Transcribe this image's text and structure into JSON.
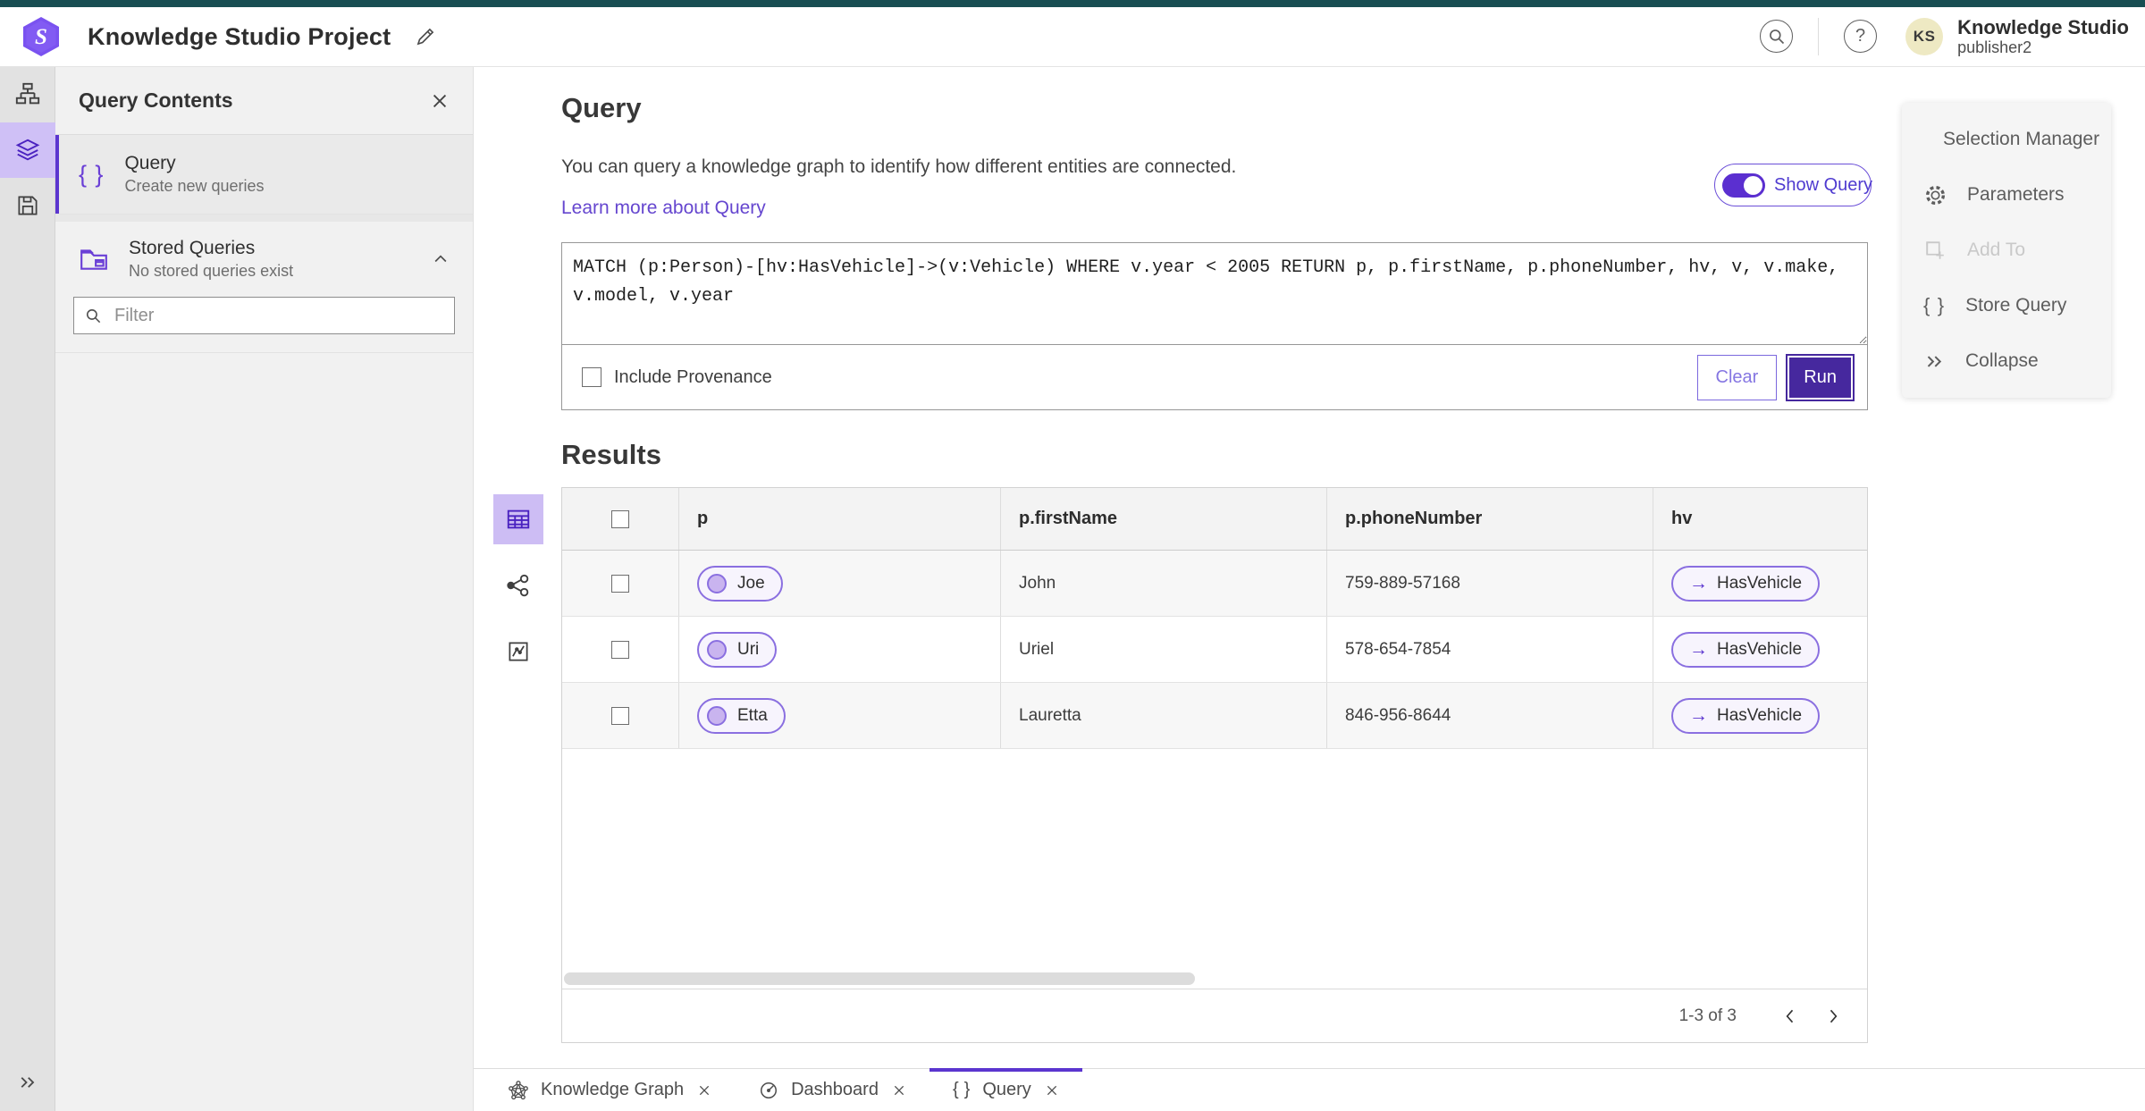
{
  "colors": {
    "accent_purple": "#5b35cf",
    "accent_deep_purple": "#46289e",
    "accent_light_purple": "#cdbdf4",
    "top_strip_teal": "#184e52",
    "avatar_yellow": "#eee9c3"
  },
  "header": {
    "app_title": "Knowledge Studio Project",
    "user_name": "Knowledge Studio",
    "user_role": "publisher2",
    "avatar_initials": "KS"
  },
  "contents_panel": {
    "title": "Query Contents",
    "query_item": {
      "label": "Query",
      "sublabel": "Create new queries"
    },
    "stored_item": {
      "label": "Stored Queries",
      "sublabel": "No stored queries exist"
    },
    "filter_placeholder": "Filter"
  },
  "query_section": {
    "heading": "Query",
    "description": "You can query a knowledge graph to identify how different entities are connected.",
    "learn_more": "Learn more about Query",
    "show_query_label": "Show Query",
    "query_text": "MATCH (p:Person)-[hv:HasVehicle]->(v:Vehicle) WHERE v.year < 2005 RETURN p, p.firstName, p.phoneNumber, hv, v, v.make, v.model, v.year",
    "include_provenance_label": "Include Provenance",
    "clear_label": "Clear",
    "run_label": "Run"
  },
  "results": {
    "heading": "Results",
    "columns": [
      "p",
      "p.firstName",
      "p.phoneNumber",
      "hv"
    ],
    "rows": [
      {
        "p": "Joe",
        "firstName": "John",
        "phoneNumber": "759-889-57168",
        "hv": "HasVehicle"
      },
      {
        "p": "Uri",
        "firstName": "Uriel",
        "phoneNumber": "578-654-7854",
        "hv": "HasVehicle"
      },
      {
        "p": "Etta",
        "firstName": "Lauretta",
        "phoneNumber": "846-956-8644",
        "hv": "HasVehicle"
      }
    ],
    "pagination": "1-3 of 3"
  },
  "actions_panel": {
    "items": [
      {
        "label": "Selection Manager"
      },
      {
        "label": "Parameters"
      },
      {
        "label": "Add To"
      },
      {
        "label": "Store Query"
      },
      {
        "label": "Collapse"
      }
    ]
  },
  "bottom_tabs": [
    {
      "label": "Knowledge Graph"
    },
    {
      "label": "Dashboard"
    },
    {
      "label": "Query"
    }
  ]
}
